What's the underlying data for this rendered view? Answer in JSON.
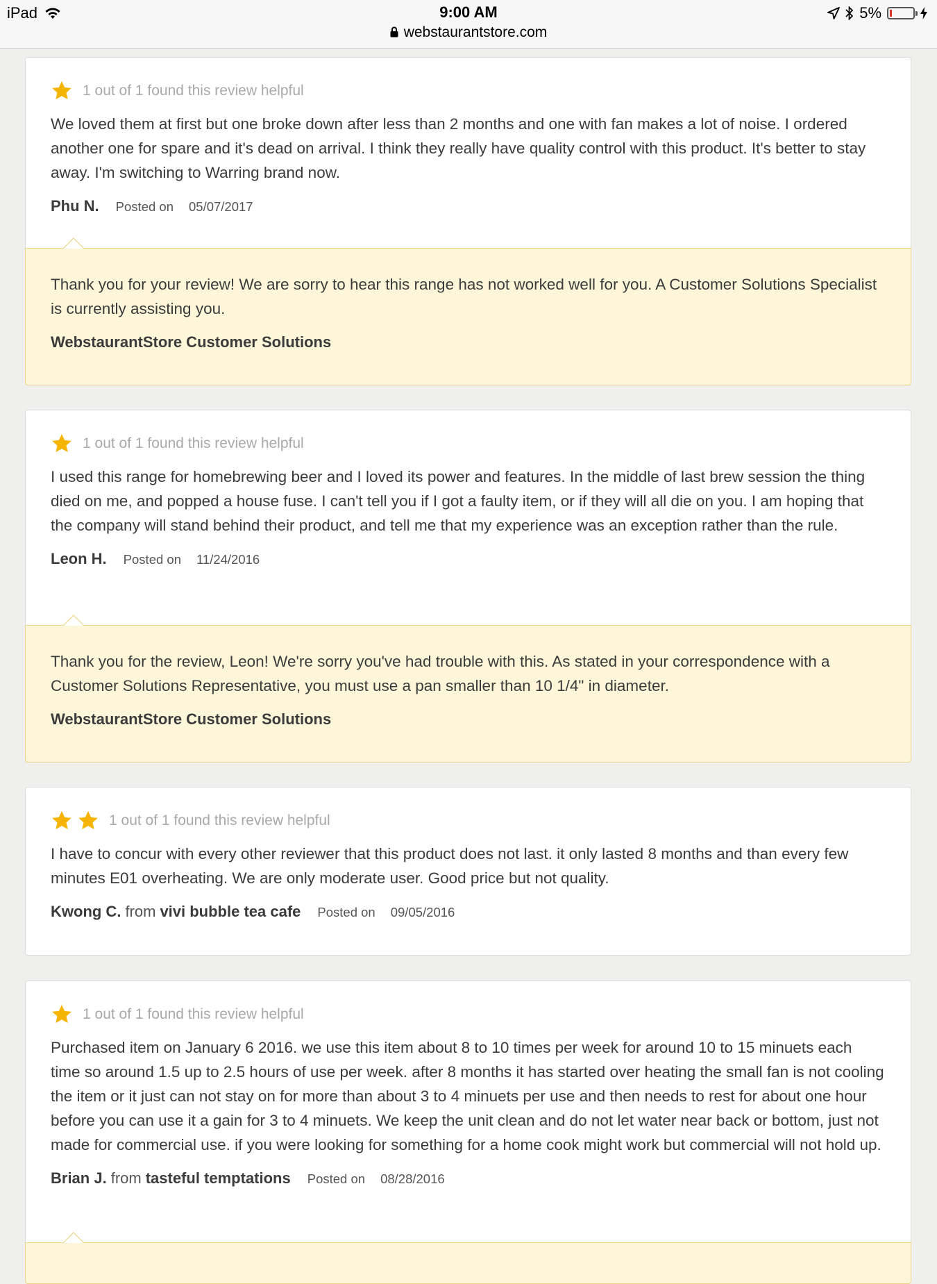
{
  "status_bar": {
    "device": "iPad",
    "time": "9:00 AM",
    "url": "webstaurantstore.com",
    "battery": "5%",
    "battery_level": 0.05
  },
  "colors": {
    "star": "#f4b400",
    "response_bg": "#fdf6d9",
    "response_border": "#ecd58a"
  },
  "reviews": [
    {
      "stars": 1,
      "helpful": "1 out of 1 found this review helpful",
      "body": "We loved them at first but one broke down after less than 2 months and one with fan makes a lot of noise. I ordered another one for spare and it's dead on arrival. I think they really have quality control with this product. It's better to stay away. I'm switching to Warring brand now.",
      "author": "Phu N.",
      "posted_label": "Posted on",
      "date": "05/07/2017",
      "response": {
        "text": "Thank you for your review! We are sorry to hear this range has not worked well for you. A Customer Solutions Specialist is currently assisting you.",
        "signature": "WebstaurantStore Customer Solutions"
      }
    },
    {
      "stars": 1,
      "helpful": "1 out of 1 found this review helpful",
      "body": "I used this range for homebrewing beer and I loved its power and features. In the middle of last brew session the thing died on me, and popped a house fuse. I can't tell you if I got a faulty item, or if they will all die on you. I am hoping that the company will stand behind their product, and tell me that my experience was an exception rather than the rule.",
      "author": "Leon H.",
      "posted_label": "Posted on",
      "date": "11/24/2016",
      "response": {
        "text": "Thank you for the review, Leon! We're sorry you've had trouble with this. As stated in your correspondence with a Customer Solutions Representative, you must use a pan smaller than 10 1/4\" in diameter.",
        "signature": "WebstaurantStore Customer Solutions"
      }
    },
    {
      "stars": 2,
      "helpful": "1 out of 1 found this review helpful",
      "body": "I have to concur with every other reviewer that this product does not last. it only lasted 8 months and than every few minutes E01 overheating. We are only moderate user. Good price but not quality.",
      "author": "Kwong C.",
      "from_label": "from",
      "company": "vivi bubble tea cafe",
      "posted_label": "Posted on",
      "date": "09/05/2016"
    },
    {
      "stars": 1,
      "helpful": "1 out of 1 found this review helpful",
      "body": "Purchased item on January 6 2016. we use this item about 8 to 10 times per week for around 10 to 15 minuets each time so around 1.5 up to 2.5 hours of use per week. after 8 months it has started over heating the small fan is not cooling the item or it just can not stay on for more than about 3 to 4 minuets per use and then needs to rest for about one hour before you can use it a gain for 3 to 4 minuets. We keep the unit clean and do not let water near back or bottom, just not made for commercial use. if you were looking for something for a home cook might work but commercial will not hold up.",
      "author": "Brian J.",
      "from_label": "from",
      "company": "tasteful temptations",
      "posted_label": "Posted on",
      "date": "08/28/2016"
    }
  ]
}
